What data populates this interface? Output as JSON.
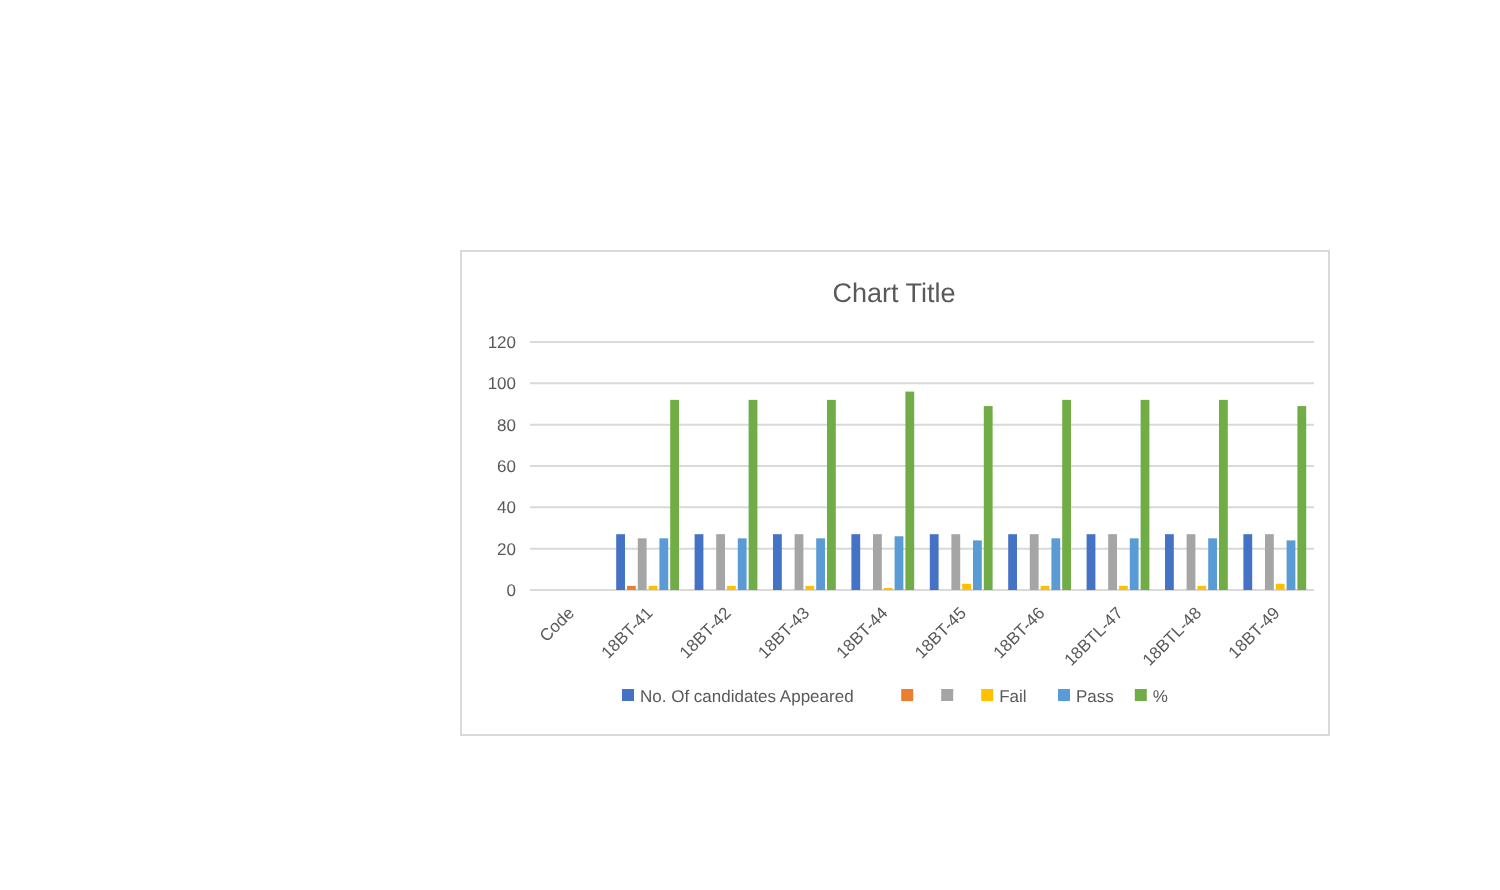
{
  "chart": {
    "chart_data": {
      "type": "bar",
      "title": "Chart Title",
      "categories": [
        "Code",
        "18BT-41",
        "18BT-42",
        "18BT-43",
        "18BT-44",
        "18BT-45",
        "18BT-46",
        "18BTL-47",
        "18BTL-48",
        "18BT-49"
      ],
      "grid": true,
      "legend": true,
      "ylim": [
        0,
        120
      ],
      "yticks": [
        0,
        20,
        40,
        60,
        80,
        100,
        120
      ],
      "series": [
        {
          "name": "No. Of candidates Appeared",
          "color": "#4472c4",
          "values": [
            null,
            27,
            27,
            27,
            27,
            27,
            27,
            27,
            27,
            27
          ]
        },
        {
          "color": "#ed7d31",
          "values": [
            null,
            2,
            null,
            null,
            null,
            null,
            null,
            null,
            null,
            null
          ]
        },
        {
          "color": "#a5a5a5",
          "values": [
            null,
            25,
            27,
            27,
            27,
            27,
            27,
            27,
            27,
            27
          ]
        },
        {
          "name": "Fail",
          "color": "#ffc000",
          "values": [
            null,
            2,
            2,
            2,
            1,
            3,
            2,
            2,
            2,
            3
          ]
        },
        {
          "name": "Pass",
          "color": "#5b9bd5",
          "values": [
            null,
            25,
            25,
            25,
            26,
            24,
            25,
            25,
            25,
            24
          ]
        },
        {
          "name": "%",
          "color": "#70ad47",
          "values": [
            null,
            92,
            92,
            92,
            96,
            89,
            92,
            92,
            92,
            89
          ]
        }
      ]
    }
  }
}
